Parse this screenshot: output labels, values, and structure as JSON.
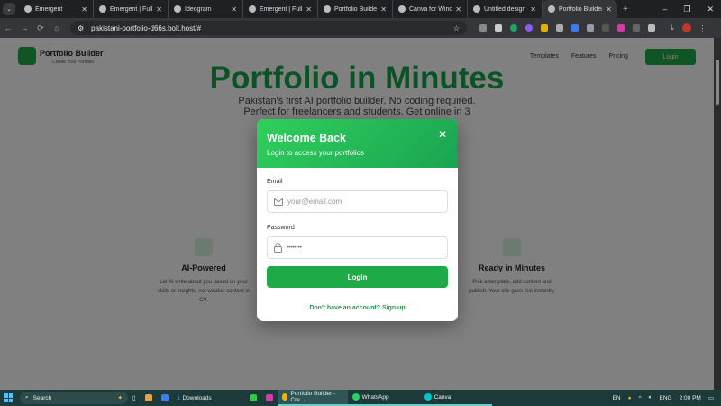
{
  "browser": {
    "tabs": [
      {
        "label": "Emergent"
      },
      {
        "label": "Emergent | Fullsta"
      },
      {
        "label": "Ideogram"
      },
      {
        "label": "Emergent | Fullsta"
      },
      {
        "label": "Portfolio Builder -"
      },
      {
        "label": "Canva for Window"
      },
      {
        "label": "Untitled design -"
      },
      {
        "label": "Portfolio Builder -"
      }
    ],
    "url": "pakistani-portfolio-d66s.bolt.host/#"
  },
  "background": {
    "logo_title": "Portfolio Builder",
    "logo_subtitle": "Create Your Portfolio",
    "nav": [
      "Templates",
      "Features",
      "Pricing"
    ],
    "login": "Login",
    "hero": "Portfolio in Minutes",
    "sub1": "Pakistan's first AI portfolio builder. No coding required.",
    "sub2": "Perfect for freelancers and students. Get online in 3",
    "cards": [
      {
        "title": "AI-Powered",
        "text": "Let AI write about you based on your skills or insights, not weaker context in CV."
      },
      {
        "title": "Ready in Minutes",
        "text": "Pick a template, add content and publish. Your site goes live instantly."
      }
    ]
  },
  "modal": {
    "title": "Welcome Back",
    "subtitle": "Login to access your portfolios",
    "email_label": "Email",
    "email_placeholder": "your@email.com",
    "password_label": "Password",
    "password_value": "••••••••",
    "login_button": "Login",
    "signup_link": "Don't have an account? Sign up"
  },
  "taskbar": {
    "search": "Search",
    "items": [
      "Downloads",
      "Portfolio Builder - Cre...",
      "WhatsApp",
      "Canva"
    ],
    "lang": "EN",
    "lang2": "ENG",
    "time": "2:00 PM"
  }
}
